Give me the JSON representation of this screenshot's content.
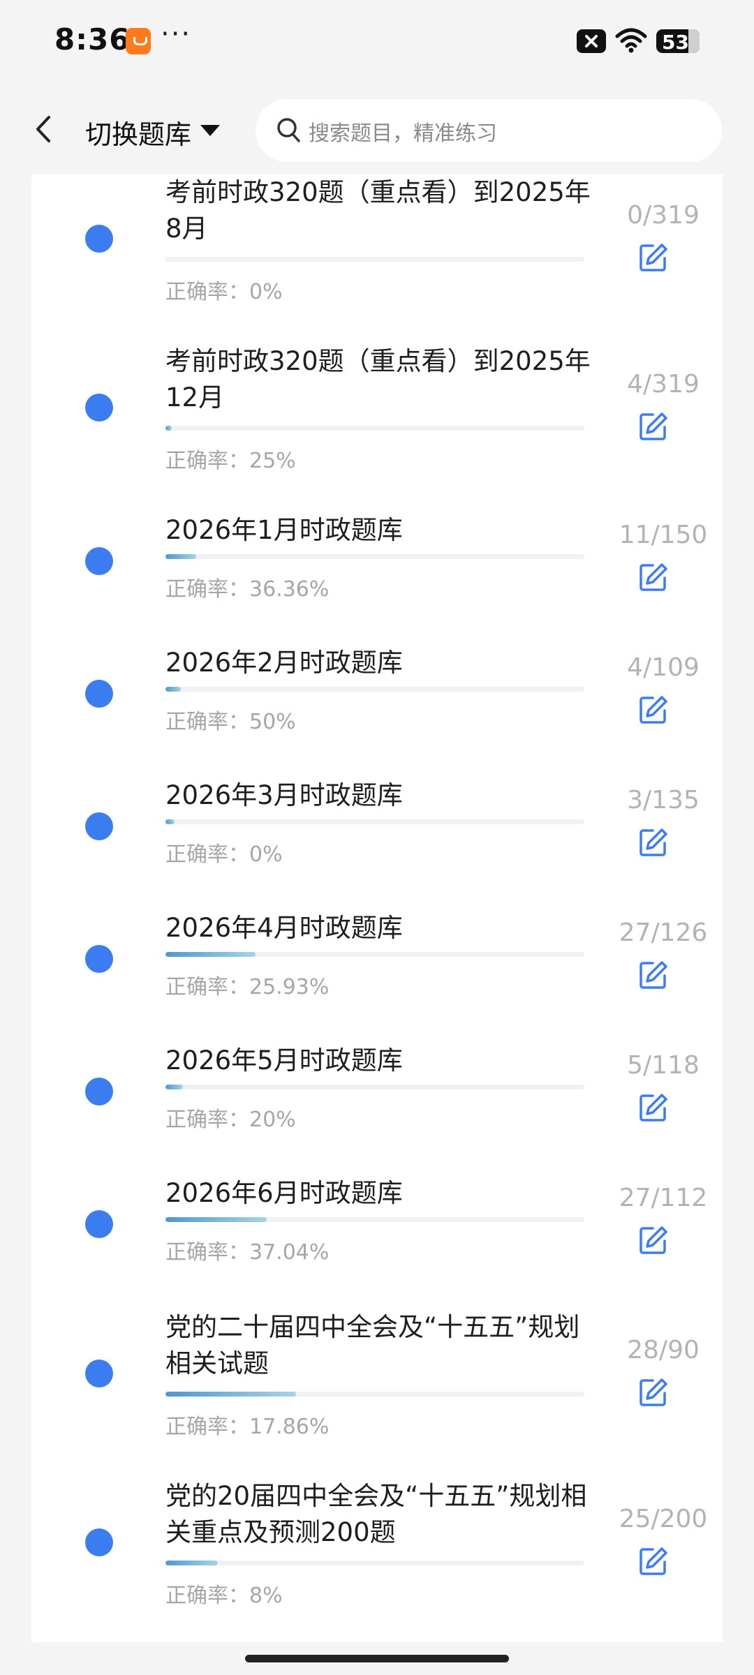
{
  "status_bar": {
    "time": "8:36",
    "more": "···",
    "battery": "53",
    "icons": [
      "app-notification-icon",
      "close-icon",
      "wifi-icon",
      "battery-icon"
    ]
  },
  "header": {
    "title": "切换题库",
    "search_placeholder": "搜索题目，精准练习"
  },
  "colors": {
    "dot": "#3b7cf0",
    "edit_icon": "#3b7cf0",
    "progress_start": "#4f97cf",
    "progress_end": "#a7d4e3"
  },
  "items": [
    {
      "title": "考前时政320题（重点看）到2025年8月",
      "accuracy": "正确率：0%",
      "count": "0/319",
      "progress": 0.0
    },
    {
      "title": "考前时政320题（重点看）到2025年12月",
      "accuracy": "正确率：25%",
      "count": "4/319",
      "progress": 0.0125
    },
    {
      "title": "2026年1月时政题库",
      "accuracy": "正确率：36.36%",
      "count": "11/150",
      "progress": 0.0733
    },
    {
      "title": "2026年2月时政题库",
      "accuracy": "正确率：50%",
      "count": "4/109",
      "progress": 0.0367
    },
    {
      "title": "2026年3月时政题库",
      "accuracy": "正确率：0%",
      "count": "3/135",
      "progress": 0.0222
    },
    {
      "title": "2026年4月时政题库",
      "accuracy": "正确率：25.93%",
      "count": "27/126",
      "progress": 0.2143
    },
    {
      "title": "2026年5月时政题库",
      "accuracy": "正确率：20%",
      "count": "5/118",
      "progress": 0.0424
    },
    {
      "title": "2026年6月时政题库",
      "accuracy": "正确率：37.04%",
      "count": "27/112",
      "progress": 0.2411
    },
    {
      "title": "党的二十届四中全会及“十五五”规划相关试题",
      "accuracy": "正确率：17.86%",
      "count": "28/90",
      "progress": 0.3111
    },
    {
      "title": "党的20届四中全会及“十五五”规划相关重点及预测200题",
      "accuracy": "正确率：8%",
      "count": "25/200",
      "progress": 0.125
    }
  ]
}
